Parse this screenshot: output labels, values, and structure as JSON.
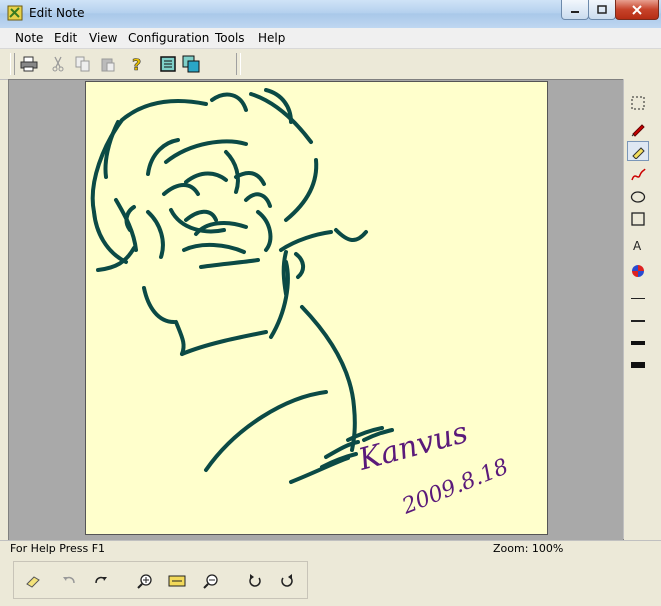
{
  "window": {
    "title": "Edit Note",
    "controls": [
      "minimize-icon",
      "maximize-icon",
      "close-icon"
    ]
  },
  "menu": {
    "items": [
      {
        "label": "Note"
      },
      {
        "label": "Edit"
      },
      {
        "label": "View"
      },
      {
        "label": "Configuration"
      },
      {
        "label": "Tools"
      },
      {
        "label": "Help"
      }
    ]
  },
  "toolbar": {
    "icons": [
      "print-icon",
      "cut-icon",
      "copy-icon",
      "paste-icon",
      "help-icon",
      "note-view-icon",
      "multi-note-icon"
    ]
  },
  "canvas": {
    "background": "#ffffcc",
    "ink_color": "#0b4a45",
    "signature": "Kanvus",
    "date": "2009.8.18",
    "signature_color": "#5a1a7a"
  },
  "side_tools": [
    "select-rect-icon",
    "pen-icon",
    "highlighter-icon",
    "freehand-line-icon",
    "ellipse-icon",
    "rectangle-icon",
    "text-tool-icon",
    "color-picker-icon",
    "line-thin-icon",
    "line-medium-icon",
    "line-thick-icon",
    "line-thicker-icon"
  ],
  "status": {
    "help": "For Help Press F1",
    "zoom": "Zoom: 100%"
  },
  "bottom_tools": [
    "eraser-icon",
    "undo-icon",
    "redo-icon",
    "zoom-in-icon",
    "fit-page-icon",
    "zoom-out-icon",
    "rotate-right-icon",
    "rotate-left-icon"
  ]
}
